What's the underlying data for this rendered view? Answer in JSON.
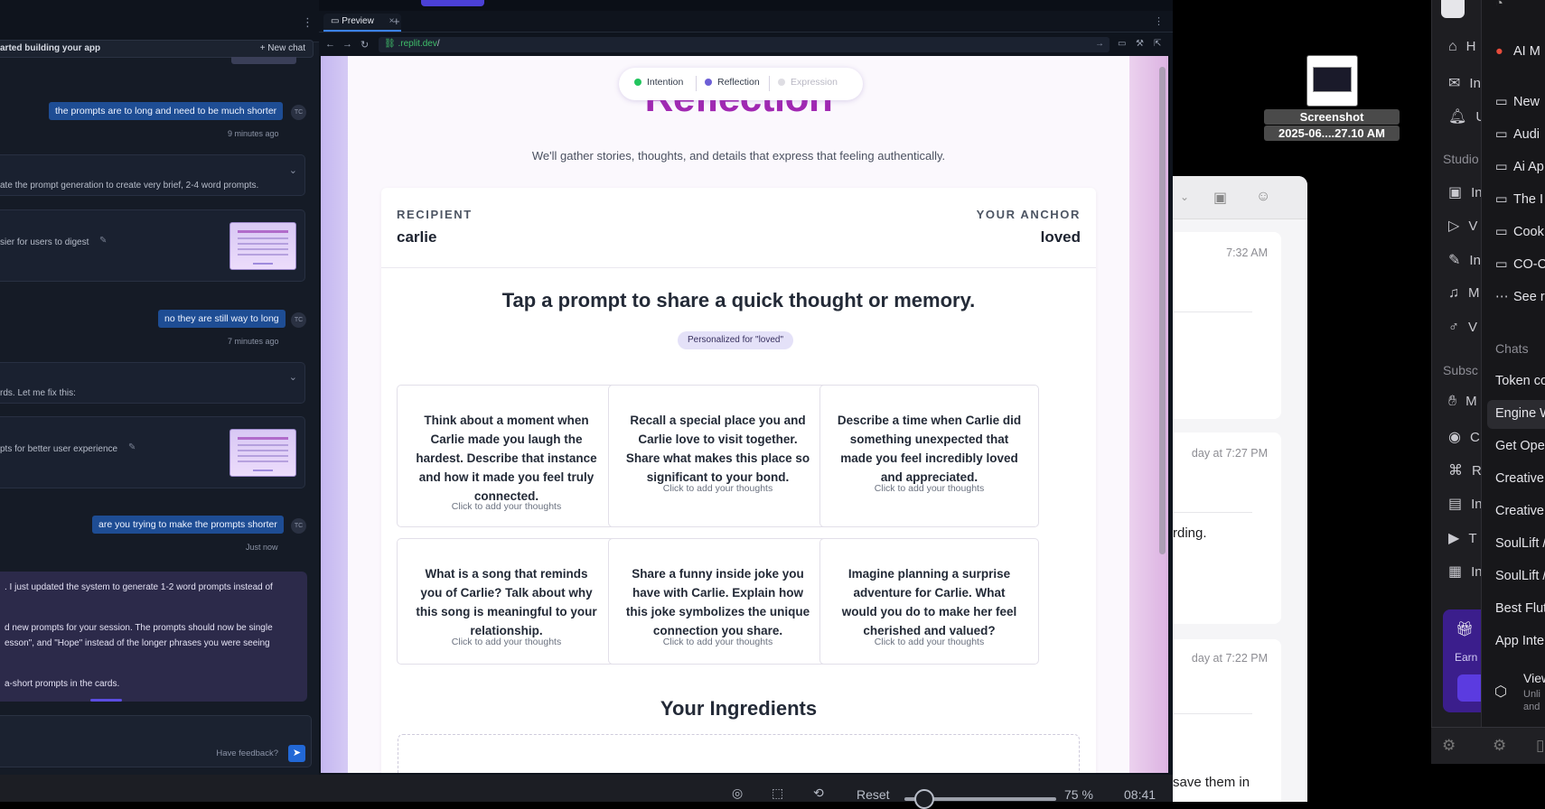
{
  "chat": {
    "header": "arted building your app",
    "new_chat": "+ New chat",
    "avatar": "TC",
    "msg1": "the prompts are to long and need to be much shorter",
    "msg1_time": "9 minutes ago",
    "agent1": "ate the prompt generation to create very brief, 2-4 word prompts.",
    "check1": "sier for users to digest",
    "msg2": "no they are still way to long",
    "msg2_time": "7 minutes ago",
    "agent2": "rds. Let me fix this:",
    "check2": "pts for better user experience",
    "msg3": "are you trying to make the prompts shorter",
    "msg3_time": "Just now",
    "final_l1": ". I just updated the system to generate 1-2 word prompts instead of",
    "final_l2": "d new prompts for your session. The prompts should now be single",
    "final_l3": "esson\", and \"Hope\" instead of the longer phrases you were seeing",
    "final_l4": "a-short prompts in the cards.",
    "feedback": "Have feedback?"
  },
  "preview": {
    "tab_label": "Preview",
    "url_host": ".replit.dev",
    "url_path": "/"
  },
  "app": {
    "steps": [
      "Intention",
      "Reflection",
      "Expression"
    ],
    "step_colors": [
      "#22c55e",
      "#6d5fd6",
      "#d9d9de"
    ],
    "title": "Reflection",
    "subtitle": "We'll gather stories, thoughts, and details that express that feeling authentically.",
    "recipient_label": "RECIPIENT",
    "recipient_value": "carlie",
    "anchor_label": "YOUR ANCHOR",
    "anchor_value": "loved",
    "prompt_heading": "Tap a prompt to share a quick thought or memory.",
    "badge": "Personalized for \"loved\"",
    "prompts": [
      "Think about a moment when Carlie made you laugh the hardest. Describe that instance and how it made you feel truly connected.",
      "Recall a special place you and Carlie love to visit together. Share what makes this place so significant to your bond.",
      "Describe a time when Carlie did something unexpected that made you feel incredibly loved and appreciated.",
      "What is a song that reminds you of Carlie? Talk about why this song is meaningful to your relationship.",
      "Share a funny inside joke you have with Carlie. Explain how this joke symbolizes the unique connection you share.",
      "Imagine planning a surprise adventure for Carlie. What would you do to make her feel cherished and valued?"
    ],
    "hint": "Click to add your thoughts",
    "ingredients": "Your Ingredients"
  },
  "bottombar": {
    "reset": "Reset",
    "zoom": "75 %",
    "time": "08:41",
    "zoom_fraction": 0.13
  },
  "desktop": {
    "ss_line1": "Screenshot",
    "ss_line2": "2025-06....27.10 AM"
  },
  "mail": {
    "t1": "7:32 AM",
    "t2": "day at 7:27 PM",
    "t2_text": "rding.",
    "t3": "day at 7:22 PM",
    "t3_text": "save them in"
  },
  "sideA": {
    "items": [
      "H",
      "In",
      "U",
      "In",
      "V",
      "In",
      "M",
      "V",
      "M",
      "C",
      "R",
      "In",
      "T",
      "In"
    ],
    "studio": "Studio",
    "subsc": "Subsc",
    "earn": "Earn"
  },
  "sideB": {
    "top": [
      "AI M",
      "New",
      "Audi",
      "Ai Ap",
      "The I",
      "Cook",
      "CO-C",
      "See r"
    ],
    "chats_head": "Chats",
    "chats": [
      "Token co",
      "Engine W",
      "Get Ope",
      "Creative",
      "Creative",
      "SoulLift /",
      "SoulLift /",
      "Best Flut",
      "App Inter"
    ],
    "view": "View",
    "view_sub1": "Unli",
    "view_sub2": "and"
  }
}
